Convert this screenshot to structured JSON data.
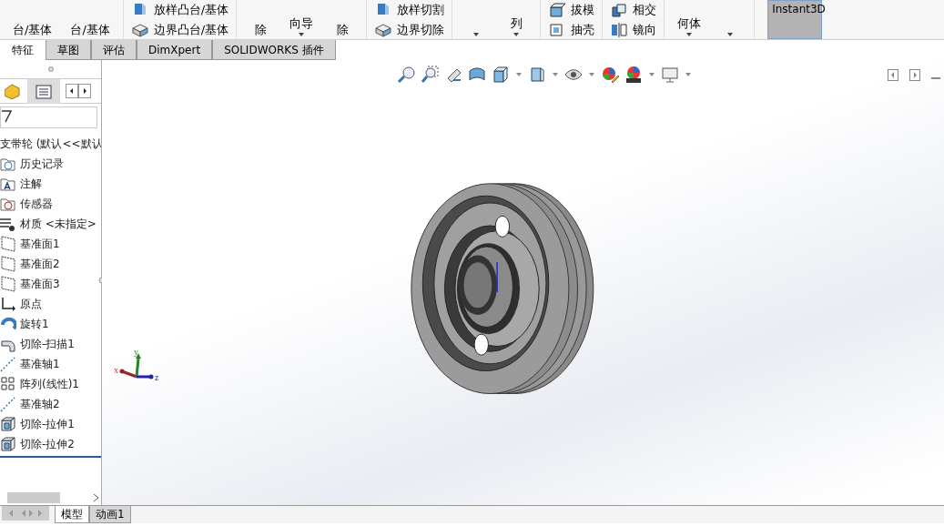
{
  "ribbon": {
    "groups": [
      {
        "kind": "big",
        "items": [
          {
            "label": "台/基体"
          },
          {
            "label": "台/基体"
          }
        ]
      },
      {
        "kind": "small",
        "items": [
          {
            "label": "放样凸台/基体",
            "kind": "loft"
          },
          {
            "label": "边界凸台/基体",
            "kind": "boundary"
          }
        ]
      },
      {
        "kind": "big",
        "items": [
          {
            "label": "除"
          },
          {
            "label": "向导",
            "dropdown": true
          },
          {
            "label": "除"
          }
        ]
      },
      {
        "kind": "small",
        "items": [
          {
            "label": "放样切割",
            "kind": "loft"
          },
          {
            "label": "边界切除",
            "kind": "boundary"
          }
        ]
      },
      {
        "kind": "big",
        "items": [
          {
            "dropdown": true
          },
          {
            "label": "列",
            "dropdown": true
          }
        ]
      },
      {
        "kind": "small",
        "items": [
          {
            "label": "拔模",
            "kind": "draft"
          },
          {
            "label": "抽壳",
            "kind": "shell"
          }
        ]
      },
      {
        "kind": "small",
        "items": [
          {
            "label": "相交",
            "kind": "intersect"
          },
          {
            "label": "镜向",
            "kind": "mirror"
          }
        ]
      },
      {
        "kind": "big",
        "items": [
          {
            "label": "何体",
            "dropdown": true
          },
          {
            "dropdown": true
          }
        ]
      },
      {
        "kind": "toggle",
        "items": [
          {
            "label": "Instant3D",
            "selected": true
          }
        ]
      }
    ]
  },
  "command_tabs": [
    {
      "label": "特征",
      "selected": true
    },
    {
      "label": "草图",
      "selected": false
    },
    {
      "label": "评估",
      "selected": false
    },
    {
      "label": "DimXpert",
      "selected": false
    },
    {
      "label": "SOLIDWORKS 插件",
      "selected": false
    }
  ],
  "tree": {
    "root": "支带轮 (默认<<默认",
    "items": [
      {
        "label": "历史记录",
        "kind": "history"
      },
      {
        "label": "注解",
        "kind": "annotation"
      },
      {
        "label": "传感器",
        "kind": "sensor"
      },
      {
        "label": "材质 <未指定>",
        "kind": "material"
      },
      {
        "label": "基准面1",
        "kind": "plane"
      },
      {
        "label": "基准面2",
        "kind": "plane"
      },
      {
        "label": "基准面3",
        "kind": "plane"
      },
      {
        "label": "原点",
        "kind": "origin"
      },
      {
        "label": "旋转1",
        "kind": "revolve"
      },
      {
        "label": "切除-扫描1",
        "kind": "sweep"
      },
      {
        "label": "基准轴1",
        "kind": "axis"
      },
      {
        "label": "阵列(线性)1",
        "kind": "pattern"
      },
      {
        "label": "基准轴2",
        "kind": "axis"
      },
      {
        "label": "切除-拉伸1",
        "kind": "extrude"
      },
      {
        "label": "切除-拉伸2",
        "kind": "extrude"
      }
    ]
  },
  "triad": {
    "x": "x",
    "y": "y",
    "z": "z"
  },
  "bottom_tabs": [
    {
      "label": "模型",
      "selected": true
    },
    {
      "label": "动画1",
      "selected": false
    }
  ]
}
